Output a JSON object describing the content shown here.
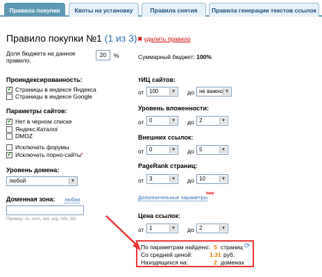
{
  "tabs": [
    {
      "label": "Правила покупки",
      "active": true
    },
    {
      "label": "Квоты на установку",
      "active": false
    },
    {
      "label": "Правила снятия",
      "active": false
    },
    {
      "label": "Правила генерации текстов ссылок",
      "active": false
    }
  ],
  "header": {
    "title": "Правило покупки №1",
    "count": "(1 из 3)"
  },
  "delete": {
    "icon": "delete-x-icon",
    "label": "удалить правило"
  },
  "budget": {
    "label_line1": "Доля бюджета на данное",
    "label_line2": "правило:",
    "value": "20",
    "unit": "%",
    "summary_label": "Суммарный бюджет:",
    "summary_value": "100%"
  },
  "indexing": {
    "title": "Проиндексированность:",
    "items": [
      {
        "label": "Страницы в индексе Яндекса",
        "checked": true
      },
      {
        "label": "Страницы в индексе Google",
        "checked": false
      }
    ]
  },
  "site_params": {
    "title": "Параметры сайтов:",
    "items": [
      {
        "label": "Нет в черном списке",
        "checked": true
      },
      {
        "label": "Яндекс.Каталог",
        "checked": false
      },
      {
        "label": "DMOZ",
        "checked": false
      },
      {
        "label": "Исключать форумы",
        "checked": false
      },
      {
        "label": "Исключать порно-сайты",
        "checked": true,
        "marker": "*"
      }
    ]
  },
  "domain_level": {
    "title": "Уровень домена:",
    "value": "любой"
  },
  "domain_zone": {
    "title": "Доменная зона:",
    "link": "любая",
    "placeholder": "Пример: ru, com, net, org, info, biz"
  },
  "tic": {
    "title": "тИЦ сайтов:",
    "from_label": "от",
    "from": "100",
    "to_label": "до",
    "to": "не важно"
  },
  "depth": {
    "title": "Уровень вложенности:",
    "from_label": "от",
    "from": "0",
    "to_label": "до",
    "to": "2"
  },
  "external": {
    "title": "Внешних ссылок:",
    "from_label": "от",
    "from": "0",
    "to_label": "до",
    "to": "5"
  },
  "pagerank": {
    "title": "PageRank страниц:",
    "from_label": "от",
    "from": "3",
    "to_label": "до",
    "to": "10"
  },
  "extra": {
    "link": "Дополнительные параметры",
    "badge": "new"
  },
  "price": {
    "title": "Цена ссылок:",
    "from_label": "от",
    "from": "1",
    "to_label": "до",
    "to": "2"
  },
  "results": {
    "found_label": "По параметрам найдено:",
    "found_value": "5",
    "found_unit": "страниц",
    "avg_label": "Со средней ценой:",
    "avg_value": "1.31",
    "avg_unit": "руб.",
    "domains_label": "Находящихся на:",
    "domains_value": "2",
    "domains_unit": "доменах"
  },
  "colors": {
    "tab_active": "#5f98b5",
    "highlight": "#e33",
    "accent_orange": "#e07b00"
  }
}
